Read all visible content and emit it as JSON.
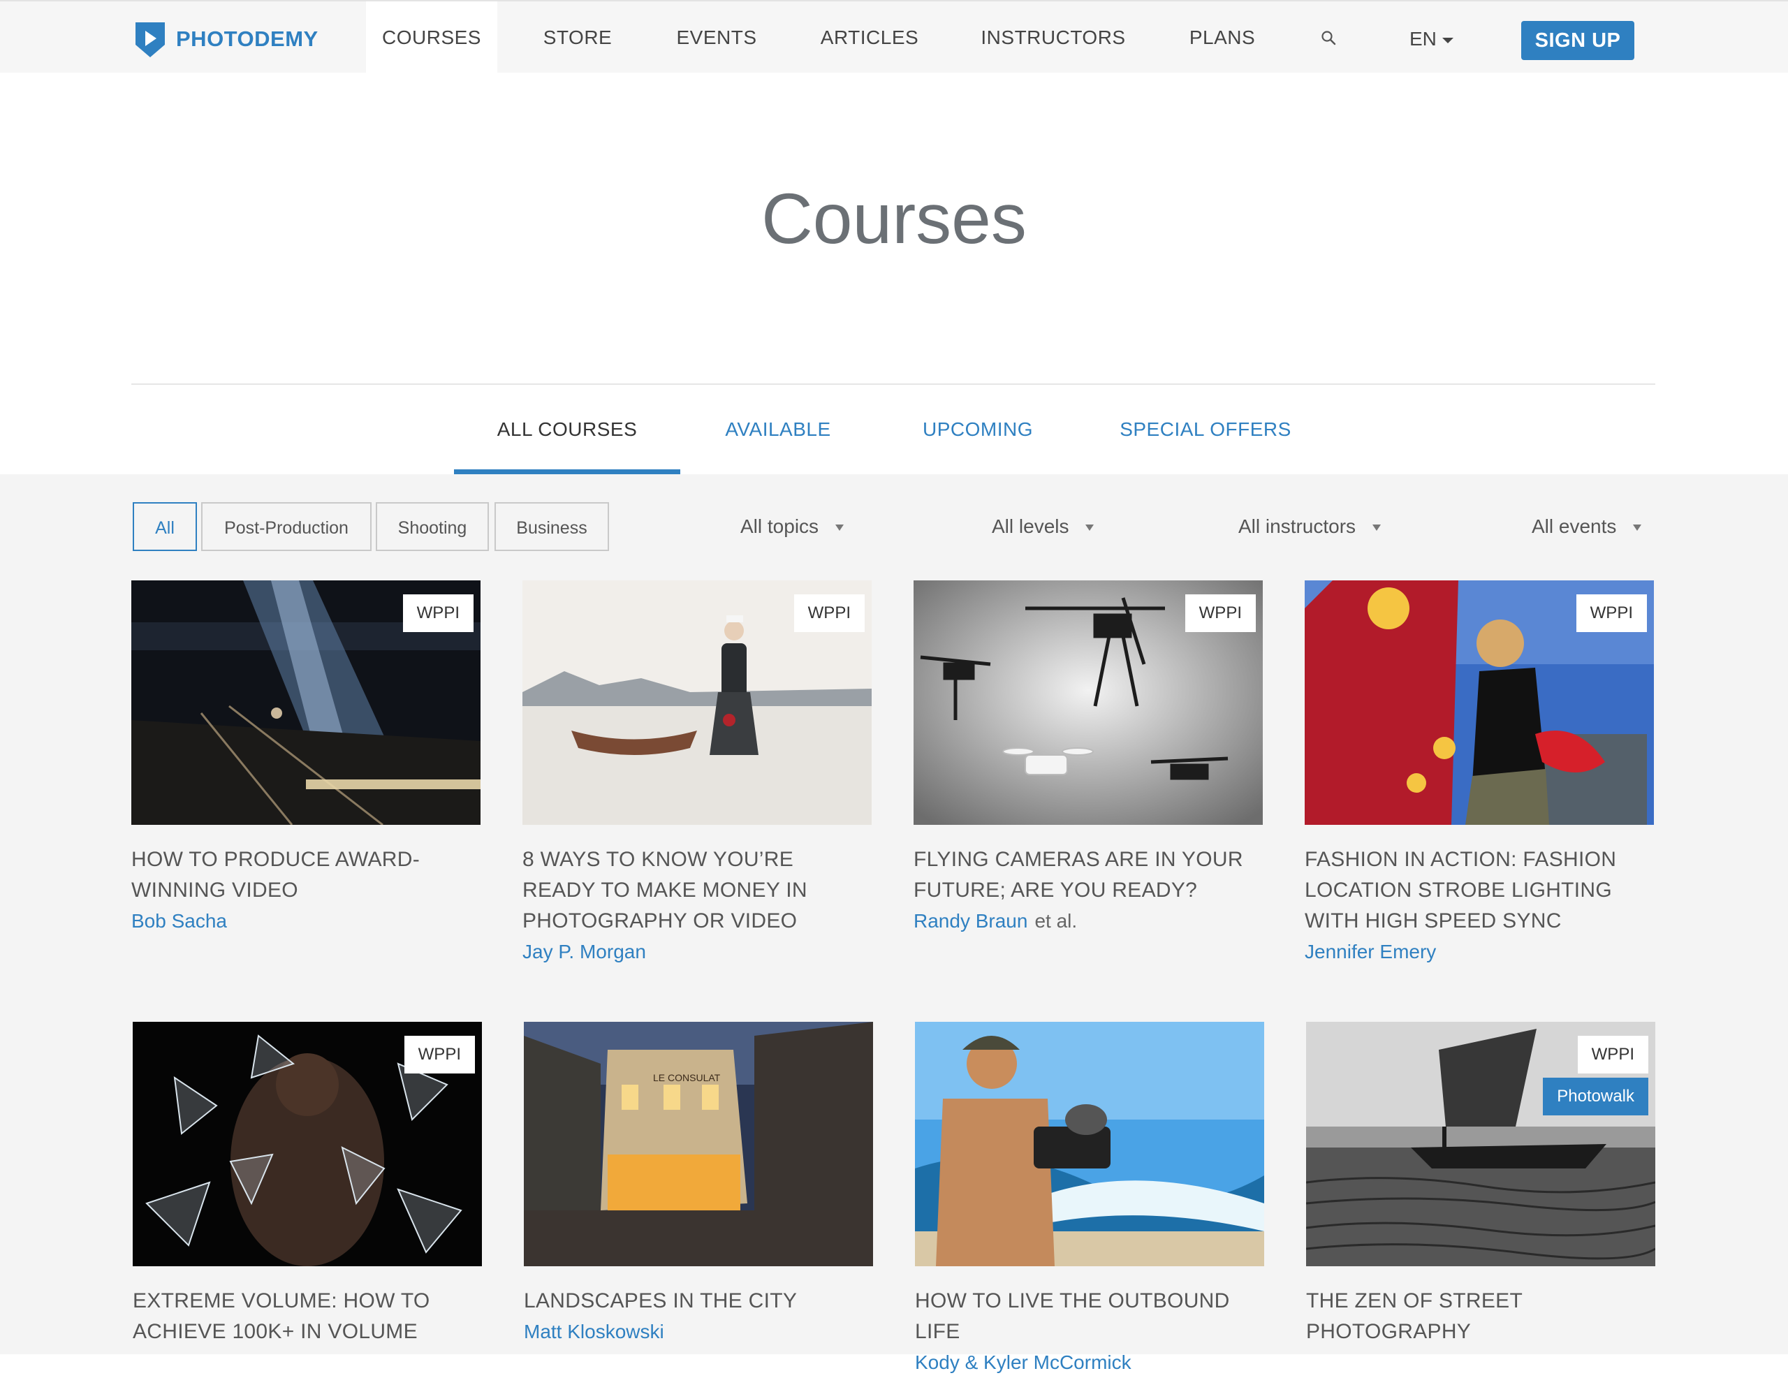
{
  "nav": {
    "brand": "PHOTODEMY",
    "items": [
      "COURSES",
      "STORE",
      "EVENTS",
      "ARTICLES",
      "INSTRUCTORS",
      "PLANS"
    ],
    "language": "EN",
    "signup": "SIGN UP"
  },
  "page": {
    "title": "Courses"
  },
  "tabs": [
    "ALL COURSES",
    "AVAILABLE",
    "UPCOMING",
    "SPECIAL OFFERS"
  ],
  "categories": [
    "All",
    "Post-Production",
    "Shooting",
    "Business"
  ],
  "filters": [
    "All topics",
    "All levels",
    "All instructors",
    "All events"
  ],
  "courses": [
    {
      "title": "HOW TO PRODUCE AWARD-WINNING VIDEO",
      "author": "Bob Sacha",
      "badge": "WPPI"
    },
    {
      "title": "8 WAYS TO KNOW YOU’RE READY TO MAKE MONEY IN PHOTOGRAPHY OR VIDEO",
      "author": "Jay P. Morgan",
      "badge": "WPPI"
    },
    {
      "title": "FLYING CAMERAS ARE IN YOUR FUTURE; ARE YOU READY?",
      "author": "Randy Braun",
      "extra": "et al.",
      "badge": "WPPI"
    },
    {
      "title": "FASHION IN ACTION: FASHION LOCATION STROBE LIGHTING WITH HIGH SPEED SYNC",
      "author": "Jennifer Emery",
      "badge": "WPPI"
    },
    {
      "title": "EXTREME VOLUME: HOW TO ACHIEVE 100K+ IN VOLUME",
      "author": "",
      "badge": "WPPI"
    },
    {
      "title": "LANDSCAPES IN THE CITY",
      "author": "Matt Kloskowski",
      "badge": ""
    },
    {
      "title": "HOW TO LIVE THE OUTBOUND LIFE",
      "author": "Kody & Kyler McCormick",
      "badge": ""
    },
    {
      "title": "THE ZEN OF STREET PHOTOGRAPHY",
      "author": "",
      "badge": "WPPI",
      "badge2": "Photowalk"
    }
  ],
  "images": {
    "c5_sign": "LE CONSULAT"
  },
  "colors": {
    "accent": "#2f80c1",
    "nav_bg": "#f6f6f6",
    "content_bg": "#f4f4f4"
  }
}
